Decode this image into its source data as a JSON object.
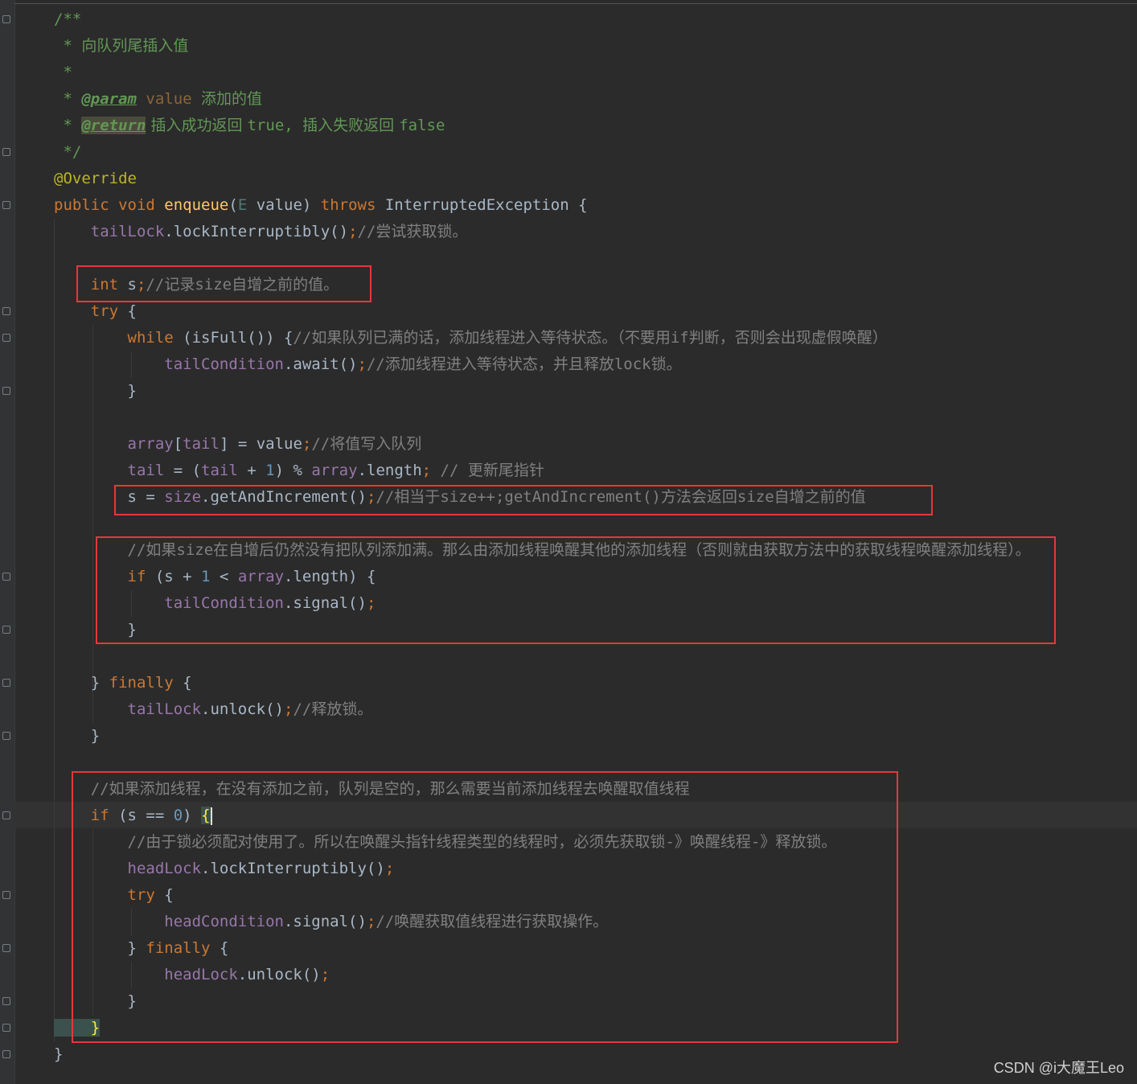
{
  "editor": {
    "lines": [
      {
        "segs": [
          {
            "c": "dc",
            "t": "/**"
          }
        ]
      },
      {
        "segs": [
          {
            "c": "dc",
            "t": " * "
          },
          {
            "c": "dcs",
            "t": "向队列尾插入值"
          }
        ]
      },
      {
        "segs": [
          {
            "c": "dc",
            "t": " *"
          }
        ]
      },
      {
        "segs": [
          {
            "c": "dc",
            "t": " * "
          },
          {
            "c": "tag",
            "t": "@param"
          },
          {
            "c": "pv",
            "t": " value "
          },
          {
            "c": "dcs",
            "t": "添加的值"
          }
        ]
      },
      {
        "segs": [
          {
            "c": "dc",
            "t": " * "
          },
          {
            "c": "tag tagbg",
            "t": "@return"
          },
          {
            "c": "dcs",
            "t": " 插入成功返回 "
          },
          {
            "c": "dc",
            "t": "true, "
          },
          {
            "c": "dcs",
            "t": "插入失败返回 "
          },
          {
            "c": "dc",
            "t": "false"
          }
        ]
      },
      {
        "segs": [
          {
            "c": "dc",
            "t": " */"
          }
        ]
      },
      {
        "segs": [
          {
            "c": "an",
            "t": "@Override"
          }
        ]
      },
      {
        "segs": [
          {
            "c": "kw",
            "t": "public void "
          },
          {
            "c": "fn",
            "t": "enqueue"
          },
          {
            "c": "",
            "t": "("
          },
          {
            "c": "tp",
            "t": "E"
          },
          {
            "c": "",
            "t": " value) "
          },
          {
            "c": "kw",
            "t": "throws "
          },
          {
            "c": "",
            "t": "InterruptedException {"
          }
        ]
      },
      {
        "segs": [
          {
            "c": "fld",
            "t": "    tailLock"
          },
          {
            "c": "",
            "t": ".lockInterruptibly()"
          },
          {
            "c": "kw",
            "t": ";"
          },
          {
            "c": "cmm",
            "t": "//"
          },
          {
            "c": "cm",
            "t": "尝试获取锁。"
          }
        ]
      },
      {
        "segs": []
      },
      {
        "segs": [
          {
            "c": "kw",
            "t": "    int "
          },
          {
            "c": "",
            "t": "s"
          },
          {
            "c": "kw",
            "t": ";"
          },
          {
            "c": "cmm",
            "t": "//"
          },
          {
            "c": "cm",
            "t": "记录"
          },
          {
            "c": "cmm",
            "t": "size"
          },
          {
            "c": "cm",
            "t": "自增之前的值。"
          }
        ]
      },
      {
        "segs": [
          {
            "c": "kw",
            "t": "    try "
          },
          {
            "c": "",
            "t": "{"
          }
        ]
      },
      {
        "segs": [
          {
            "c": "kw",
            "t": "        while "
          },
          {
            "c": "",
            "t": "(isFull()) {"
          },
          {
            "c": "cmm",
            "t": "//"
          },
          {
            "c": "cm",
            "t": "如果队列已满的话，添加线程进入等待状态。（不要用"
          },
          {
            "c": "cmm",
            "t": "if"
          },
          {
            "c": "cm",
            "t": "判断，否则会出现虚假唤醒）"
          }
        ]
      },
      {
        "segs": [
          {
            "c": "fld",
            "t": "            tailCondition"
          },
          {
            "c": "",
            "t": ".await()"
          },
          {
            "c": "kw",
            "t": ";"
          },
          {
            "c": "cmm",
            "t": "//"
          },
          {
            "c": "cm",
            "t": "添加线程进入等待状态，并且释放"
          },
          {
            "c": "cmm",
            "t": "lock"
          },
          {
            "c": "cm",
            "t": "锁。"
          }
        ]
      },
      {
        "segs": [
          {
            "c": "",
            "t": "        }"
          }
        ]
      },
      {
        "segs": []
      },
      {
        "segs": [
          {
            "c": "fld",
            "t": "        array"
          },
          {
            "c": "",
            "t": "["
          },
          {
            "c": "fld",
            "t": "tail"
          },
          {
            "c": "",
            "t": "] = value"
          },
          {
            "c": "kw",
            "t": ";"
          },
          {
            "c": "cmm",
            "t": "//"
          },
          {
            "c": "cm",
            "t": "将值写入队列"
          }
        ]
      },
      {
        "segs": [
          {
            "c": "fld",
            "t": "        tail "
          },
          {
            "c": "",
            "t": "= ("
          },
          {
            "c": "fld",
            "t": "tail "
          },
          {
            "c": "",
            "t": "+ "
          },
          {
            "c": "num",
            "t": "1"
          },
          {
            "c": "",
            "t": ") % "
          },
          {
            "c": "fld",
            "t": "array"
          },
          {
            "c": "",
            "t": ".length"
          },
          {
            "c": "kw",
            "t": "; "
          },
          {
            "c": "cmm",
            "t": "// "
          },
          {
            "c": "cm",
            "t": "更新尾指针"
          }
        ]
      },
      {
        "segs": [
          {
            "c": "",
            "t": "        s = "
          },
          {
            "c": "fld",
            "t": "size"
          },
          {
            "c": "",
            "t": ".getAndIncrement()"
          },
          {
            "c": "kw",
            "t": ";"
          },
          {
            "c": "cmm",
            "t": "//"
          },
          {
            "c": "cm",
            "t": "相当于"
          },
          {
            "c": "cmm",
            "t": "size++;getAndIncrement()"
          },
          {
            "c": "cm",
            "t": "方法会返回"
          },
          {
            "c": "cmm",
            "t": "size"
          },
          {
            "c": "cm",
            "t": "自增之前的值"
          }
        ]
      },
      {
        "segs": []
      },
      {
        "segs": [
          {
            "c": "cmm",
            "t": "        //"
          },
          {
            "c": "cm",
            "t": "如果"
          },
          {
            "c": "cmm",
            "t": "size"
          },
          {
            "c": "cm",
            "t": "在自增后仍然没有把队列添加满。那么由添加线程唤醒其他的添加线程（否则就由获取方法中的获取线程唤醒添加线程）。"
          }
        ]
      },
      {
        "segs": [
          {
            "c": "kw",
            "t": "        if "
          },
          {
            "c": "",
            "t": "(s + "
          },
          {
            "c": "num",
            "t": "1 "
          },
          {
            "c": "",
            "t": "< "
          },
          {
            "c": "fld",
            "t": "array"
          },
          {
            "c": "",
            "t": ".length) {"
          }
        ]
      },
      {
        "segs": [
          {
            "c": "fld",
            "t": "            tailCondition"
          },
          {
            "c": "",
            "t": ".signal()"
          },
          {
            "c": "kw",
            "t": ";"
          }
        ]
      },
      {
        "segs": [
          {
            "c": "",
            "t": "        }"
          }
        ]
      },
      {
        "segs": []
      },
      {
        "segs": [
          {
            "c": "",
            "t": "    } "
          },
          {
            "c": "kw",
            "t": "finally "
          },
          {
            "c": "",
            "t": "{"
          }
        ]
      },
      {
        "segs": [
          {
            "c": "fld",
            "t": "        tailLock"
          },
          {
            "c": "",
            "t": ".unlock()"
          },
          {
            "c": "kw",
            "t": ";"
          },
          {
            "c": "cmm",
            "t": "//"
          },
          {
            "c": "cm",
            "t": "释放锁。"
          }
        ]
      },
      {
        "segs": [
          {
            "c": "",
            "t": "    }"
          }
        ]
      },
      {
        "segs": []
      },
      {
        "segs": [
          {
            "c": "cmm",
            "t": "    //"
          },
          {
            "c": "cm",
            "t": "如果添加线程，在没有添加之前，队列是空的，那么需要当前添加线程去唤醒取值线程"
          }
        ]
      },
      {
        "segs": [
          {
            "c": "kw",
            "t": "    if "
          },
          {
            "c": "",
            "t": "(s == "
          },
          {
            "c": "num",
            "t": "0"
          },
          {
            "c": "",
            "t": ") "
          },
          {
            "c": "br-hl",
            "t": "{"
          }
        ],
        "cursor": true
      },
      {
        "segs": [
          {
            "c": "cmm",
            "t": "        //"
          },
          {
            "c": "cm",
            "t": "由于锁必须配对使用了。所以在唤醒头指针线程类型的线程时，必须先获取锁"
          },
          {
            "c": "cmm",
            "t": "-"
          },
          {
            "c": "cm",
            "t": "》唤醒线程"
          },
          {
            "c": "cmm",
            "t": "-"
          },
          {
            "c": "cm",
            "t": "》释放锁。"
          }
        ]
      },
      {
        "segs": [
          {
            "c": "fld",
            "t": "        headLock"
          },
          {
            "c": "",
            "t": ".lockInterruptibly()"
          },
          {
            "c": "kw",
            "t": ";"
          }
        ]
      },
      {
        "segs": [
          {
            "c": "kw",
            "t": "        try "
          },
          {
            "c": "",
            "t": "{"
          }
        ]
      },
      {
        "segs": [
          {
            "c": "fld",
            "t": "            headCondition"
          },
          {
            "c": "",
            "t": ".signal()"
          },
          {
            "c": "kw",
            "t": ";"
          },
          {
            "c": "cmm",
            "t": "//"
          },
          {
            "c": "cm",
            "t": "唤醒获取值线程进行获取操作。"
          }
        ]
      },
      {
        "segs": [
          {
            "c": "",
            "t": "        } "
          },
          {
            "c": "kw",
            "t": "finally "
          },
          {
            "c": "",
            "t": "{"
          }
        ]
      },
      {
        "segs": [
          {
            "c": "fld",
            "t": "            headLock"
          },
          {
            "c": "",
            "t": ".unlock()"
          },
          {
            "c": "kw",
            "t": ";"
          }
        ]
      },
      {
        "segs": [
          {
            "c": "",
            "t": "        }"
          }
        ]
      },
      {
        "segs": [
          {
            "c": "br-hl",
            "t": "    }"
          }
        ]
      },
      {
        "segs": [
          {
            "c": "",
            "t": "}"
          }
        ]
      }
    ]
  },
  "watermark": "CSDN @i大魔王Leo"
}
